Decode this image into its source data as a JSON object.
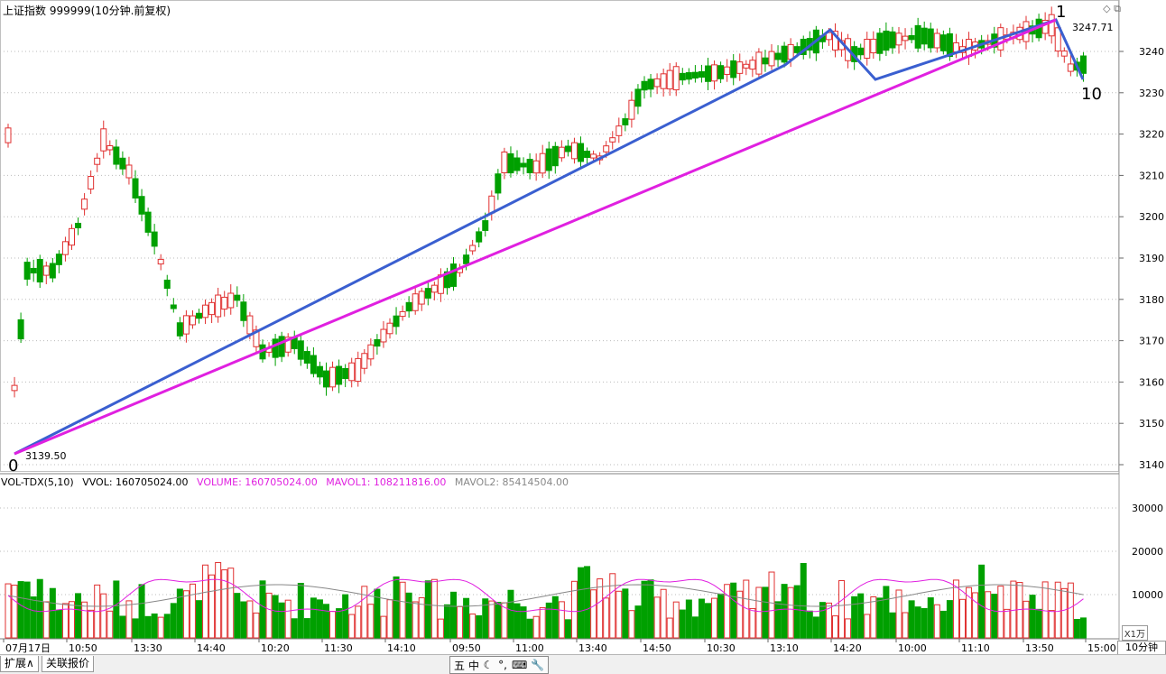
{
  "header": {
    "title": "上证指数 999999(10分钟.前复权)",
    "corner_icons": [
      "diamond-icon",
      "restore-window-icon"
    ]
  },
  "chart": {
    "labels": {
      "start_wave": "0",
      "peak_wave": "1",
      "end_wave": "10"
    },
    "low_label": "3139.50",
    "high_label": "3247.71",
    "price_axis": [
      "3240",
      "3230",
      "3220",
      "3210",
      "3200",
      "3190",
      "3180",
      "3170",
      "3160",
      "3150",
      "3140"
    ],
    "volume_axis": [
      "30000",
      "20000",
      "10000"
    ],
    "volume_unit": "X1万",
    "time_axis": [
      "07月17日",
      "10:50",
      "13:30",
      "14:40",
      "10:20",
      "11:30",
      "14:10",
      "09:50",
      "11:00",
      "13:40",
      "14:50",
      "10:30",
      "13:10",
      "14:20",
      "10:00",
      "11:10",
      "13:50",
      "15:00"
    ]
  },
  "volume_header": {
    "name": "VOL-TDX(5,10)",
    "vvol": "VVOL: 160705024.00",
    "volume": "VOLUME: 160705024.00",
    "mavol1": "MAVOL1: 108211816.00",
    "mavol2": "MAVOL2: 85414504.00"
  },
  "statusbar": {
    "expand_tab": "扩展∧",
    "related_tab": "关联报价",
    "period": "10分钟",
    "ime": [
      "五",
      "中",
      "☾",
      "°,",
      "⌨",
      "🔧"
    ]
  },
  "colors": {
    "up": "#e03030",
    "down": "#00a000",
    "blue_line": "#3a5fd0",
    "magenta_line": "#e020e0",
    "mavol2": "#888888"
  }
}
